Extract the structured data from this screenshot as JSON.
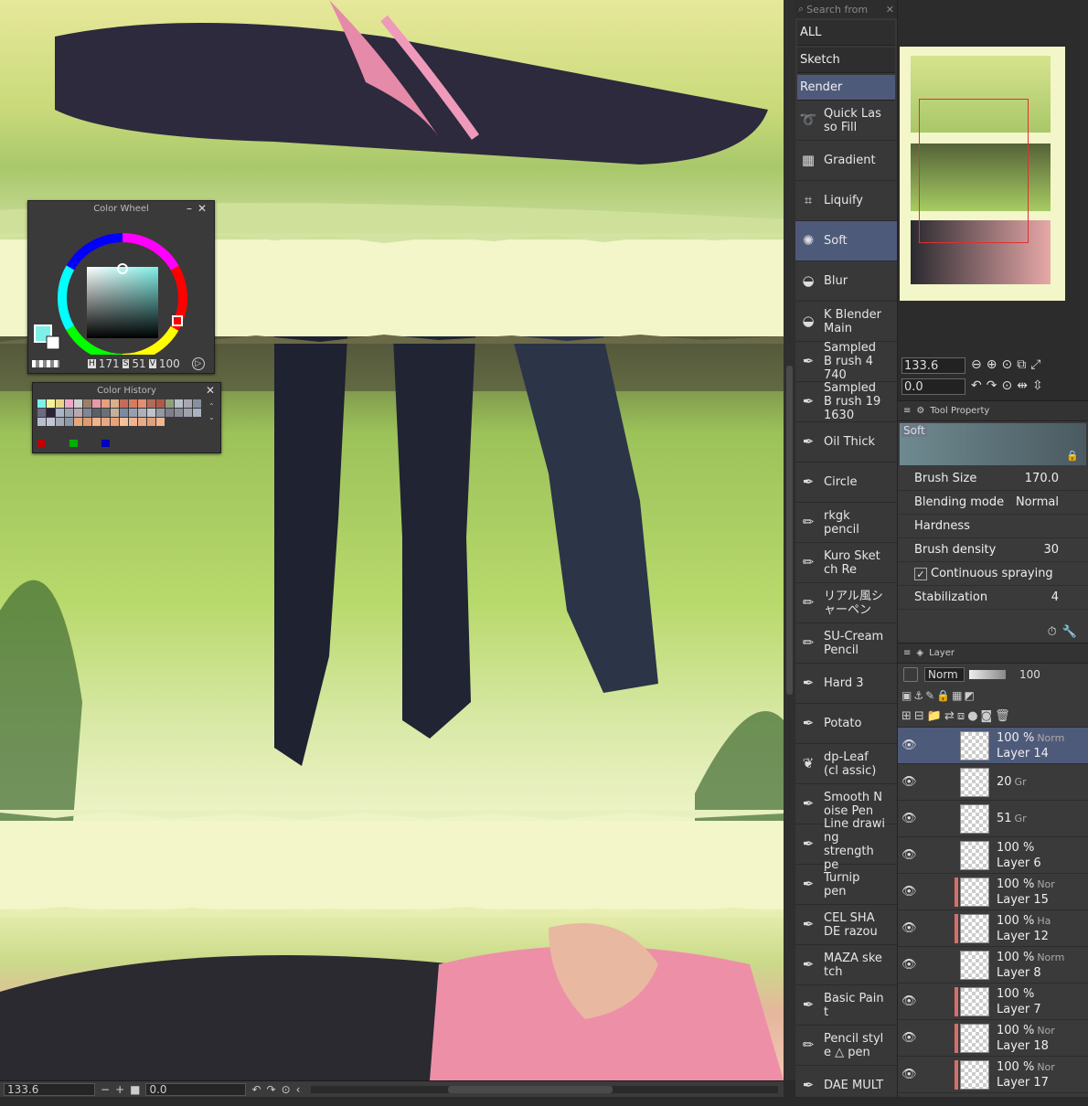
{
  "status_bar": {
    "zoom": "133.6",
    "angle": "0.0"
  },
  "color_wheel": {
    "title": "Color Wheel",
    "h_label": "H",
    "h_value": "171",
    "s_label": "S",
    "s_value": "51",
    "v_label": "V",
    "v_value": "100",
    "current_color": "#7ff0e8"
  },
  "color_history": {
    "title": "Color History",
    "swatches": [
      "#7ff0e8",
      "#f5f19a",
      "#e9d58a",
      "#f3a7c7",
      "#cfcfcf",
      "#9a7f6a",
      "#e59aa8",
      "#e4a080",
      "#d8b08a",
      "#c66a5a",
      "#d87c60",
      "#e28f72",
      "#b26b5a",
      "#ad5a4b",
      "#8ea07a",
      "#b7c0c8",
      "#a8a6b0",
      "#8890a0",
      "#6a6a80",
      "#2a2238",
      "#a9b4c4",
      "#9aa2b0",
      "#b7a8b0",
      "#7e8794",
      "#5a6068",
      "#6b6f7a",
      "#c3b09a",
      "#7a8aa0",
      "#989fb1",
      "#aeb0b8",
      "#bfc2c8",
      "#9497a4",
      "#7c7e8a",
      "#8c8c98",
      "#9ea2ae",
      "#a9b2c0",
      "#b7bfcc",
      "#c1c7d1",
      "#a3a9b7",
      "#8e98a8",
      "#e8a77a",
      "#e09b6e",
      "#f0b48c",
      "#eaa882",
      "#e7a27a",
      "#f4c09a",
      "#efb38e",
      "#e9aa84",
      "#e1a07a",
      "#f0b692"
    ],
    "bottom": [
      "#c00000",
      "#00b000",
      "#0000c0"
    ]
  },
  "brush_search_placeholder": "Search from",
  "brush_sets": [
    "ALL",
    "Sketch",
    "Render"
  ],
  "brushes": [
    {
      "name": "Quick Las so Fill",
      "icon": "lasso-icon"
    },
    {
      "name": "Gradient",
      "icon": "gradient-icon"
    },
    {
      "name": "Liquify",
      "icon": "liquify-icon"
    },
    {
      "name": "Soft",
      "icon": "airbrush-icon"
    },
    {
      "name": "Blur",
      "icon": "drop-icon"
    },
    {
      "name": "K Blender Main",
      "icon": "drop-icon"
    },
    {
      "name": "Sampled B rush 4 740",
      "icon": "pen-icon"
    },
    {
      "name": "Sampled B rush 19 1630",
      "icon": "pen-icon"
    },
    {
      "name": "Oil Thick",
      "icon": "pen-icon"
    },
    {
      "name": "Circle",
      "icon": "pen-icon"
    },
    {
      "name": "rkgk pencil",
      "icon": "pencil-icon"
    },
    {
      "name": "Kuro Sket ch Re",
      "icon": "pencil-icon"
    },
    {
      "name": "リアル風シャーペン",
      "icon": "pencil-icon"
    },
    {
      "name": "SU-Cream Pencil",
      "icon": "pencil-icon"
    },
    {
      "name": "Hard 3",
      "icon": "pen-icon"
    },
    {
      "name": "Potato",
      "icon": "pen-icon"
    },
    {
      "name": "dp-Leaf (cl assic)",
      "icon": "leaf-icon"
    },
    {
      "name": "Smooth N oise Pen",
      "icon": "pen-icon"
    },
    {
      "name": "Line drawi ng strength pe",
      "icon": "pen-icon"
    },
    {
      "name": "Turnip pen",
      "icon": "pen-icon"
    },
    {
      "name": "CEL SHA DE razou",
      "icon": "pen-icon"
    },
    {
      "name": "MAZA ske tch",
      "icon": "pen-icon"
    },
    {
      "name": "Basic Pain t",
      "icon": "pen-icon"
    },
    {
      "name": "Pencil styl e △ pen",
      "icon": "pencil-icon"
    },
    {
      "name": "DAE MULT",
      "icon": "pen-icon"
    }
  ],
  "navigator": {
    "zoom": "133.6",
    "angle": "0.0"
  },
  "tool_property": {
    "tab": "Tool Property",
    "brush_name": "Soft",
    "props": [
      {
        "label": "Brush Size",
        "value": "170.0"
      },
      {
        "label": "Blending mode",
        "value": "Normal"
      },
      {
        "label": "Hardness",
        "value": ""
      },
      {
        "label": "Brush density",
        "value": "30"
      },
      {
        "label": "Continuous spraying",
        "value": ""
      },
      {
        "label": "Stabilization",
        "value": "4"
      }
    ]
  },
  "layer_panel": {
    "tab": "Layer",
    "blend": "Norm",
    "opacity": "100",
    "layers": [
      {
        "pct": "100 %",
        "mode": "Norm",
        "name": "Layer 14",
        "sel": true,
        "red": false
      },
      {
        "pct": "20",
        "mode": "Gr",
        "name": "",
        "sel": false,
        "red": false
      },
      {
        "pct": "51",
        "mode": "Gr",
        "name": "",
        "sel": false,
        "red": false
      },
      {
        "pct": "100 %",
        "mode": "",
        "name": "Layer 6",
        "sel": false,
        "red": false
      },
      {
        "pct": "100 %",
        "mode": "Nor",
        "name": "Layer 15",
        "sel": false,
        "red": true
      },
      {
        "pct": "100 %",
        "mode": "Ha",
        "name": "Layer 12",
        "sel": false,
        "red": true
      },
      {
        "pct": "100 %",
        "mode": "Norm",
        "name": "Layer 8",
        "sel": false,
        "red": false
      },
      {
        "pct": "100 %",
        "mode": "",
        "name": "Layer 7",
        "sel": false,
        "red": true
      },
      {
        "pct": "100 %",
        "mode": "Nor",
        "name": "Layer 18",
        "sel": false,
        "red": true
      },
      {
        "pct": "100 %",
        "mode": "Nor",
        "name": "Layer 17",
        "sel": false,
        "red": true
      }
    ]
  }
}
